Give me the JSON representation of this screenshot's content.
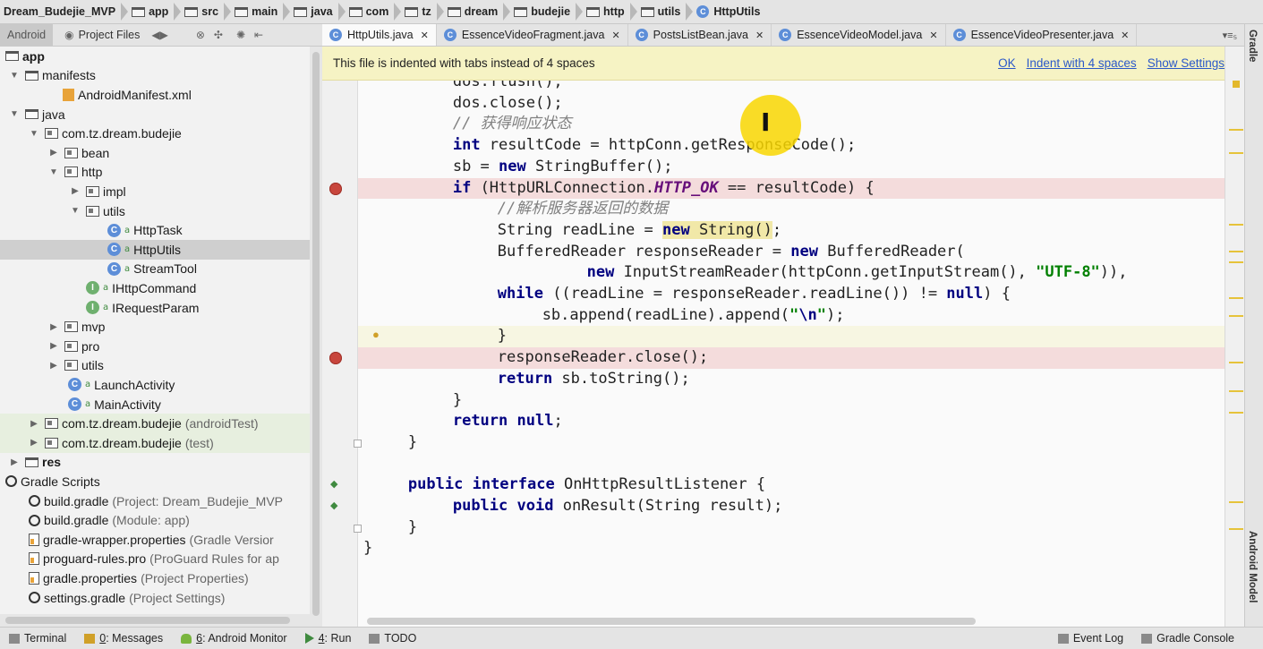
{
  "breadcrumb": [
    {
      "label": "Dream_Budejie_MVP",
      "icon": "none"
    },
    {
      "label": "app",
      "icon": "folder-icon"
    },
    {
      "label": "src",
      "icon": "folder-icon"
    },
    {
      "label": "main",
      "icon": "folder-icon"
    },
    {
      "label": "java",
      "icon": "folder-icon"
    },
    {
      "label": "com",
      "icon": "folder-icon"
    },
    {
      "label": "tz",
      "icon": "folder-icon"
    },
    {
      "label": "dream",
      "icon": "folder-icon"
    },
    {
      "label": "budejie",
      "icon": "folder-icon"
    },
    {
      "label": "http",
      "icon": "folder-icon"
    },
    {
      "label": "utils",
      "icon": "folder-icon"
    },
    {
      "label": "HttpUtils",
      "icon": "class-icon"
    }
  ],
  "panel": {
    "android_tab": "Android",
    "project_files_tab": "Project Files"
  },
  "tree": [
    {
      "label": "app",
      "note": "",
      "icon": "folder-icon",
      "arrow": "",
      "state": ""
    },
    {
      "label": "manifests",
      "note": "",
      "icon": "folder-icon",
      "arrow": "▼",
      "state": ""
    },
    {
      "label": "AndroidManifest.xml",
      "note": "",
      "icon": "xml-icon",
      "arrow": "",
      "state": ""
    },
    {
      "label": "java",
      "note": "",
      "icon": "folder-icon",
      "arrow": "▼",
      "state": ""
    },
    {
      "label": "com.tz.dream.budejie",
      "note": "",
      "icon": "package-icon",
      "arrow": "▼",
      "state": ""
    },
    {
      "label": "bean",
      "note": "",
      "icon": "package-icon",
      "arrow": "▶",
      "state": ""
    },
    {
      "label": "http",
      "note": "",
      "icon": "package-icon",
      "arrow": "▼",
      "state": ""
    },
    {
      "label": "impl",
      "note": "",
      "icon": "package-icon",
      "arrow": "▶",
      "state": ""
    },
    {
      "label": "utils",
      "note": "",
      "icon": "package-icon",
      "arrow": "▼",
      "state": ""
    },
    {
      "label": "HttpTask",
      "note": "",
      "icon": "class-icon",
      "arrow": "",
      "state": ""
    },
    {
      "label": "HttpUtils",
      "note": "",
      "icon": "class-icon",
      "arrow": "",
      "state": "selected"
    },
    {
      "label": "StreamTool",
      "note": "",
      "icon": "class-icon",
      "arrow": "",
      "state": ""
    },
    {
      "label": "IHttpCommand",
      "note": "",
      "icon": "interface-icon",
      "arrow": "",
      "state": ""
    },
    {
      "label": "IRequestParam",
      "note": "",
      "icon": "interface-icon",
      "arrow": "",
      "state": ""
    },
    {
      "label": "mvp",
      "note": "",
      "icon": "package-icon",
      "arrow": "▶",
      "state": ""
    },
    {
      "label": "pro",
      "note": "",
      "icon": "package-icon",
      "arrow": "▶",
      "state": ""
    },
    {
      "label": "utils",
      "note": "",
      "icon": "package-icon",
      "arrow": "▶",
      "state": ""
    },
    {
      "label": "LaunchActivity",
      "note": "",
      "icon": "class-icon",
      "arrow": "",
      "state": ""
    },
    {
      "label": "MainActivity",
      "note": "",
      "icon": "class-icon",
      "arrow": "",
      "state": ""
    },
    {
      "label": "com.tz.dream.budejie",
      "note": "(androidTest)",
      "icon": "package-icon",
      "arrow": "▶",
      "state": "green"
    },
    {
      "label": "com.tz.dream.budejie",
      "note": "(test)",
      "icon": "package-icon",
      "arrow": "▶",
      "state": "green"
    },
    {
      "label": "res",
      "note": "",
      "icon": "res-folder-icon",
      "arrow": "▶",
      "state": ""
    },
    {
      "label": "Gradle Scripts",
      "note": "",
      "icon": "gradle-icon",
      "arrow": "",
      "state": ""
    },
    {
      "label": "build.gradle",
      "note": "(Project: Dream_Budejie_MVP",
      "icon": "gradle-icon",
      "arrow": "",
      "state": ""
    },
    {
      "label": "build.gradle",
      "note": "(Module: app)",
      "icon": "gradle-icon",
      "arrow": "",
      "state": ""
    },
    {
      "label": "gradle-wrapper.properties",
      "note": "(Gradle Versior",
      "icon": "properties-icon",
      "arrow": "",
      "state": ""
    },
    {
      "label": "proguard-rules.pro",
      "note": "(ProGuard Rules for ap",
      "icon": "properties-icon",
      "arrow": "",
      "state": ""
    },
    {
      "label": "gradle.properties",
      "note": "(Project Properties)",
      "icon": "properties-icon",
      "arrow": "",
      "state": ""
    },
    {
      "label": "settings.gradle",
      "note": "(Project Settings)",
      "icon": "gradle-icon",
      "arrow": "",
      "state": ""
    }
  ],
  "tabs": [
    {
      "label": "HttpUtils.java",
      "active": true
    },
    {
      "label": "EssenceVideoFragment.java",
      "active": false
    },
    {
      "label": "PostsListBean.java",
      "active": false
    },
    {
      "label": "EssenceVideoModel.java",
      "active": false
    },
    {
      "label": "EssenceVideoPresenter.java",
      "active": false
    }
  ],
  "tabs_more": "▾≡₅",
  "notice": {
    "text": "This file is indented with tabs instead of 4 spaces",
    "ok": "OK",
    "indent": "Indent with 4 spaces",
    "settings": "Show Settings"
  },
  "code": [
    {
      "indent": 2,
      "style": "",
      "marker": "",
      "parts": [
        [
          "dos.flush();",
          ""
        ]
      ]
    },
    {
      "indent": 2,
      "style": "",
      "marker": "",
      "parts": [
        [
          "dos.close();",
          ""
        ]
      ]
    },
    {
      "indent": 2,
      "style": "",
      "marker": "",
      "parts": [
        [
          "// 获得响应状态",
          "cmt"
        ]
      ]
    },
    {
      "indent": 2,
      "style": "",
      "marker": "",
      "parts": [
        [
          "int",
          "kw"
        ],
        [
          " resultCode = httpConn.getResponseCode();",
          ""
        ]
      ]
    },
    {
      "indent": 2,
      "style": "",
      "marker": "",
      "parts": [
        [
          "sb = ",
          ""
        ],
        [
          "new",
          "kw"
        ],
        [
          " StringBuffer();",
          ""
        ]
      ]
    },
    {
      "indent": 2,
      "style": "bp",
      "marker": "breakpoint",
      "parts": [
        [
          "if",
          "kw"
        ],
        [
          " (HttpURLConnection.",
          ""
        ],
        [
          "HTTP_OK",
          "const"
        ],
        [
          " == resultCode) {",
          ""
        ]
      ]
    },
    {
      "indent": 3,
      "style": "",
      "marker": "",
      "parts": [
        [
          "//解析服务器返回的数据",
          "cmt"
        ]
      ]
    },
    {
      "indent": 3,
      "style": "",
      "marker": "",
      "parts": [
        [
          "String readLine = ",
          ""
        ],
        [
          "new",
          "kw ybg"
        ],
        [
          " String()",
          "ybg"
        ],
        [
          ";",
          ""
        ]
      ]
    },
    {
      "indent": 3,
      "style": "",
      "marker": "",
      "parts": [
        [
          "BufferedReader responseReader = ",
          ""
        ],
        [
          "new",
          "kw"
        ],
        [
          " BufferedReader(",
          ""
        ]
      ]
    },
    {
      "indent": 5,
      "style": "",
      "marker": "",
      "parts": [
        [
          "new",
          "kw"
        ],
        [
          " InputStreamReader(httpConn.getInputStream(), ",
          ""
        ],
        [
          "\"UTF-8\"",
          "str"
        ],
        [
          ")),",
          ""
        ]
      ]
    },
    {
      "indent": 3,
      "style": "",
      "marker": "",
      "parts": [
        [
          "while",
          "kw"
        ],
        [
          " ((readLine = responseReader.readLine()) != ",
          ""
        ],
        [
          "null",
          "kw"
        ],
        [
          ") {",
          ""
        ]
      ]
    },
    {
      "indent": 4,
      "style": "",
      "marker": "",
      "parts": [
        [
          "sb.append(readLine).append(",
          ""
        ],
        [
          "\"",
          "str"
        ],
        [
          "\\n",
          "esc"
        ],
        [
          "\"",
          "str"
        ],
        [
          ");",
          ""
        ]
      ]
    },
    {
      "indent": 3,
      "style": "hl",
      "marker": "bulb",
      "parts": [
        [
          "}",
          ""
        ]
      ]
    },
    {
      "indent": 3,
      "style": "bp",
      "marker": "breakpoint",
      "parts": [
        [
          "responseReader.close();",
          ""
        ]
      ]
    },
    {
      "indent": 3,
      "style": "",
      "marker": "",
      "parts": [
        [
          "return",
          "kw"
        ],
        [
          " sb.toString();",
          ""
        ]
      ]
    },
    {
      "indent": 2,
      "style": "",
      "marker": "",
      "parts": [
        [
          "}",
          ""
        ]
      ]
    },
    {
      "indent": 2,
      "style": "",
      "marker": "",
      "parts": [
        [
          "return",
          "kw"
        ],
        [
          " ",
          ""
        ],
        [
          "null",
          "kw"
        ],
        [
          ";",
          ""
        ]
      ]
    },
    {
      "indent": 1,
      "style": "",
      "marker": "fold",
      "parts": [
        [
          "}",
          ""
        ]
      ]
    },
    {
      "indent": 0,
      "style": "",
      "marker": "",
      "parts": []
    },
    {
      "indent": 1,
      "style": "",
      "marker": "run",
      "parts": [
        [
          "public",
          "kw"
        ],
        [
          " ",
          ""
        ],
        [
          "interface",
          "kw"
        ],
        [
          " OnHttpResultListener {",
          ""
        ]
      ]
    },
    {
      "indent": 2,
      "style": "",
      "marker": "run",
      "parts": [
        [
          "public",
          "kw"
        ],
        [
          " ",
          ""
        ],
        [
          "void",
          "kw"
        ],
        [
          " onResult(String result);",
          ""
        ]
      ]
    },
    {
      "indent": 1,
      "style": "",
      "marker": "fold",
      "parts": [
        [
          "}",
          ""
        ]
      ]
    },
    {
      "indent": 0,
      "style": "",
      "marker": "",
      "parts": [
        [
          "}",
          ""
        ]
      ]
    }
  ],
  "cursor_icon": "ibeam-cursor-icon",
  "right_strip": {
    "top_label": "Gradle",
    "bottom_label": "Android Model"
  },
  "statusbar": {
    "terminal": "Terminal",
    "messages_num": "0",
    "messages": ": Messages",
    "monitor_num": "6",
    "monitor": ": Android Monitor",
    "run_num": "4",
    "run": ": Run",
    "todo": "TODO",
    "event_log": "Event Log",
    "gradle_console": "Gradle Console"
  },
  "colors": {
    "keyword": "#000080",
    "string": "#008000",
    "comment": "#808080",
    "breakpoint": "#c8463d",
    "notice_bg": "#f6f3c4",
    "link": "#2b58c9"
  }
}
